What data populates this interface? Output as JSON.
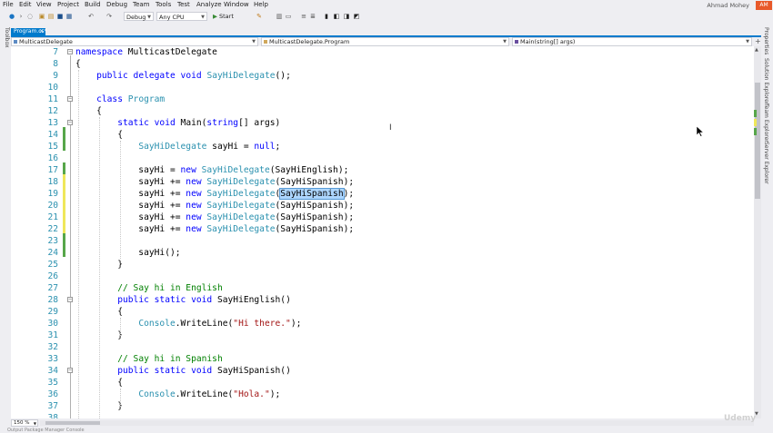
{
  "menu": [
    "File",
    "Edit",
    "View",
    "Project",
    "Build",
    "Debug",
    "Team",
    "Tools",
    "Test",
    "Analyze",
    "Window",
    "Help"
  ],
  "user": {
    "name": "Ahmad Mohey",
    "badge": "AM"
  },
  "toolbar": {
    "config": "Debug",
    "platform": "Any CPU",
    "start_label": "Start"
  },
  "left_strip_label": "Toolbox",
  "tab": {
    "label": "Program.cs*",
    "close": "×"
  },
  "nav": {
    "project": "MulticastDelegate",
    "class": "MulticastDelegate.Program",
    "member": "Main(string[] args)"
  },
  "right_labels": [
    "Properties",
    "Solution Explorer",
    "Team Explorer",
    "Server Explorer"
  ],
  "zoom": "150 %",
  "bottom_tabs": "Output   Package Manager Console",
  "watermark": "Udemy",
  "code_lines": [
    {
      "num": "7",
      "tokens": [
        {
          "t": "namespace",
          "c": "kw"
        },
        {
          "t": " MulticastDelegate"
        }
      ]
    },
    {
      "num": "8",
      "tokens": [
        {
          "t": "{"
        }
      ]
    },
    {
      "num": "9",
      "tokens": [
        {
          "t": "    "
        },
        {
          "t": "public",
          "c": "kw"
        },
        {
          "t": " "
        },
        {
          "t": "delegate",
          "c": "kw"
        },
        {
          "t": " "
        },
        {
          "t": "void",
          "c": "kw"
        },
        {
          "t": " "
        },
        {
          "t": "SayHiDelegate",
          "c": "ty"
        },
        {
          "t": "();"
        }
      ]
    },
    {
      "num": "10",
      "tokens": []
    },
    {
      "num": "11",
      "tokens": [
        {
          "t": "    "
        },
        {
          "t": "class",
          "c": "kw"
        },
        {
          "t": " "
        },
        {
          "t": "Program",
          "c": "ty"
        }
      ]
    },
    {
      "num": "12",
      "tokens": [
        {
          "t": "    {"
        }
      ]
    },
    {
      "num": "13",
      "tokens": [
        {
          "t": "        "
        },
        {
          "t": "static",
          "c": "kw"
        },
        {
          "t": " "
        },
        {
          "t": "void",
          "c": "kw"
        },
        {
          "t": " Main("
        },
        {
          "t": "string",
          "c": "kw"
        },
        {
          "t": "[] args)"
        }
      ]
    },
    {
      "num": "14",
      "tokens": [
        {
          "t": "        {"
        }
      ]
    },
    {
      "num": "15",
      "tokens": [
        {
          "t": "            "
        },
        {
          "t": "SayHiDelegate",
          "c": "ty"
        },
        {
          "t": " sayHi = "
        },
        {
          "t": "null",
          "c": "kw"
        },
        {
          "t": ";"
        }
      ]
    },
    {
      "num": "16",
      "tokens": []
    },
    {
      "num": "17",
      "tokens": [
        {
          "t": "            sayHi = "
        },
        {
          "t": "new",
          "c": "kw"
        },
        {
          "t": " "
        },
        {
          "t": "SayHiDelegate",
          "c": "ty"
        },
        {
          "t": "(SayHiEnglish);"
        }
      ]
    },
    {
      "num": "18",
      "tokens": [
        {
          "t": "            sayHi += "
        },
        {
          "t": "new",
          "c": "kw"
        },
        {
          "t": " "
        },
        {
          "t": "SayHiDelegate",
          "c": "ty"
        },
        {
          "t": "(SayHiSpanish);"
        }
      ]
    },
    {
      "num": "19",
      "tokens": [
        {
          "t": "            sayHi += "
        },
        {
          "t": "new",
          "c": "kw"
        },
        {
          "t": " "
        },
        {
          "t": "SayHiDelegate",
          "c": "ty"
        },
        {
          "t": "("
        },
        {
          "t": "SayHiSpanish",
          "c": "sel"
        },
        {
          "t": ");"
        }
      ]
    },
    {
      "num": "20",
      "tokens": [
        {
          "t": "            sayHi += "
        },
        {
          "t": "new",
          "c": "kw"
        },
        {
          "t": " "
        },
        {
          "t": "SayHiDelegate",
          "c": "ty"
        },
        {
          "t": "(SayHiSpanish);"
        }
      ]
    },
    {
      "num": "21",
      "tokens": [
        {
          "t": "            sayHi += "
        },
        {
          "t": "new",
          "c": "kw"
        },
        {
          "t": " "
        },
        {
          "t": "SayHiDelegate",
          "c": "ty"
        },
        {
          "t": "(SayHiSpanish);"
        }
      ]
    },
    {
      "num": "22",
      "tokens": [
        {
          "t": "            sayHi += "
        },
        {
          "t": "new",
          "c": "kw"
        },
        {
          "t": " "
        },
        {
          "t": "SayHiDelegate",
          "c": "ty"
        },
        {
          "t": "(SayHiSpanish);"
        }
      ]
    },
    {
      "num": "23",
      "tokens": []
    },
    {
      "num": "24",
      "tokens": [
        {
          "t": "            sayHi();"
        }
      ]
    },
    {
      "num": "25",
      "tokens": [
        {
          "t": "        }"
        }
      ]
    },
    {
      "num": "26",
      "tokens": []
    },
    {
      "num": "27",
      "tokens": [
        {
          "t": "        "
        },
        {
          "t": "// Say hi in English",
          "c": "cm"
        }
      ]
    },
    {
      "num": "28",
      "tokens": [
        {
          "t": "        "
        },
        {
          "t": "public",
          "c": "kw"
        },
        {
          "t": " "
        },
        {
          "t": "static",
          "c": "kw"
        },
        {
          "t": " "
        },
        {
          "t": "void",
          "c": "kw"
        },
        {
          "t": " SayHiEnglish()"
        }
      ]
    },
    {
      "num": "29",
      "tokens": [
        {
          "t": "        {"
        }
      ]
    },
    {
      "num": "30",
      "tokens": [
        {
          "t": "            "
        },
        {
          "t": "Console",
          "c": "ty"
        },
        {
          "t": ".WriteLine("
        },
        {
          "t": "\"Hi there.\"",
          "c": "st"
        },
        {
          "t": ");"
        }
      ]
    },
    {
      "num": "31",
      "tokens": [
        {
          "t": "        }"
        }
      ]
    },
    {
      "num": "32",
      "tokens": []
    },
    {
      "num": "33",
      "tokens": [
        {
          "t": "        "
        },
        {
          "t": "// Say hi in Spanish",
          "c": "cm"
        }
      ]
    },
    {
      "num": "34",
      "tokens": [
        {
          "t": "        "
        },
        {
          "t": "public",
          "c": "kw"
        },
        {
          "t": " "
        },
        {
          "t": "static",
          "c": "kw"
        },
        {
          "t": " "
        },
        {
          "t": "void",
          "c": "kw"
        },
        {
          "t": " SayHiSpanish()"
        }
      ]
    },
    {
      "num": "35",
      "tokens": [
        {
          "t": "        {"
        }
      ]
    },
    {
      "num": "36",
      "tokens": [
        {
          "t": "            "
        },
        {
          "t": "Console",
          "c": "ty"
        },
        {
          "t": ".WriteLine("
        },
        {
          "t": "\"Hola.\"",
          "c": "st"
        },
        {
          "t": ");"
        }
      ]
    },
    {
      "num": "37",
      "tokens": [
        {
          "t": "        }"
        }
      ]
    },
    {
      "num": "38",
      "tokens": []
    }
  ],
  "colors": {
    "keyword": "#0000ff",
    "type": "#2b91af",
    "comment": "#008000",
    "string": "#a31515",
    "accent": "#007acc"
  }
}
